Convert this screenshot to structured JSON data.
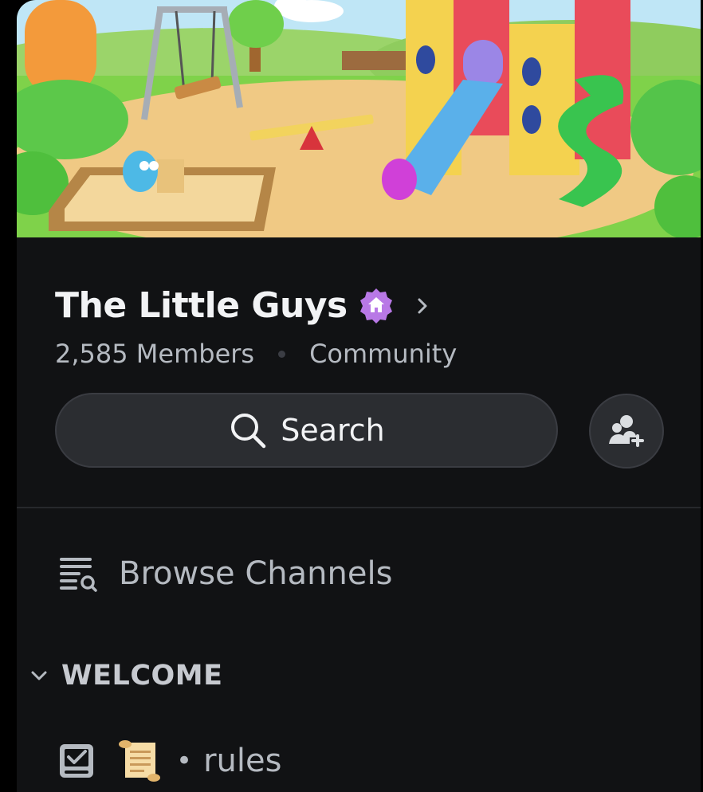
{
  "server": {
    "name": "The Little Guys",
    "member_count": "2,585 Members",
    "type": "Community",
    "badge_icon": "community-home-badge-icon",
    "badge_color": "#b878e6"
  },
  "search": {
    "label": "Search"
  },
  "invite": {
    "icon": "add-member-icon"
  },
  "browse": {
    "label": "Browse Channels"
  },
  "categories": [
    {
      "name": "WELCOME",
      "expanded": true,
      "channels": [
        {
          "name": "rules",
          "emoji_icon": "scroll-icon",
          "type_icon": "rules-checkbox-icon"
        }
      ]
    }
  ],
  "colors": {
    "background": "#111214",
    "surface": "#2b2d31",
    "text_primary": "#f2f3f5",
    "text_muted": "#b5bac1"
  }
}
